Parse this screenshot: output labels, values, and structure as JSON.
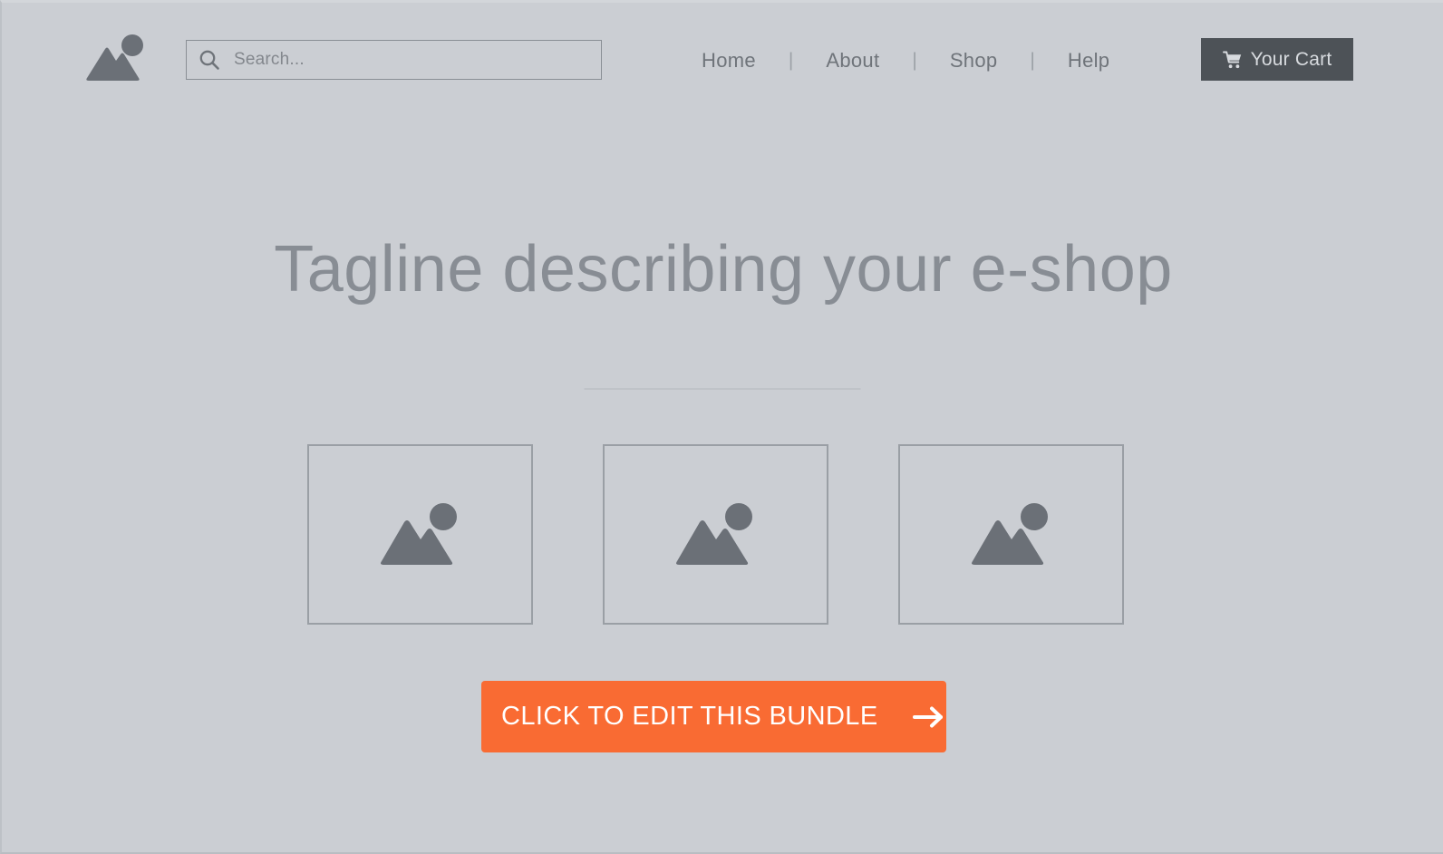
{
  "header": {
    "logo_icon": "image-placeholder-icon",
    "search": {
      "icon": "search-icon",
      "placeholder": "Search...",
      "value": ""
    },
    "nav": {
      "items": [
        {
          "label": "Home"
        },
        {
          "label": "About"
        },
        {
          "label": "Shop"
        },
        {
          "label": "Help"
        }
      ],
      "separator": "|"
    },
    "cart": {
      "icon": "shopping-cart-icon",
      "label": "Your Cart"
    }
  },
  "hero": {
    "headline": "Tagline describing your e-shop"
  },
  "gallery": {
    "cards": [
      {
        "icon": "image-placeholder-icon"
      },
      {
        "icon": "image-placeholder-icon"
      },
      {
        "icon": "image-placeholder-icon"
      }
    ]
  },
  "cta": {
    "label": "CLICK TO EDIT THIS BUNDLE",
    "icon": "arrow-right-icon"
  },
  "colors": {
    "background": "#cbced3",
    "accent_orange": "#f96b33",
    "dark_gray": "#4d5257",
    "icon_gray": "#6b7077",
    "muted_text": "#6f747a",
    "headline_text": "#888d94",
    "border_gray": "#9a9fa5"
  }
}
